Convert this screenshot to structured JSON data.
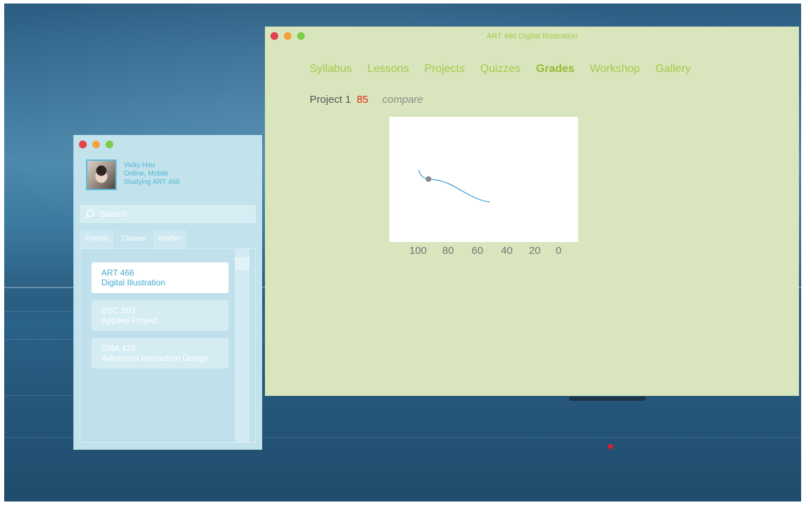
{
  "course_window": {
    "title": "ART 466 Digital Illustration",
    "tabs": [
      {
        "label": "Syllabus",
        "active": false
      },
      {
        "label": "Lessons",
        "active": false
      },
      {
        "label": "Projects",
        "active": false
      },
      {
        "label": "Quizzes",
        "active": false
      },
      {
        "label": "Grades",
        "active": true
      },
      {
        "label": "Workshop",
        "active": false
      },
      {
        "label": "Gallery",
        "active": false
      }
    ],
    "grade": {
      "project_label": "Project 1",
      "score": "85",
      "compare_label": "compare"
    },
    "chart_ticks": [
      "100",
      "80",
      "60",
      "40",
      "20",
      "0"
    ]
  },
  "friends_window": {
    "profile": {
      "name": "Vicky Hsu",
      "status": "Online, Mobile",
      "activity": "Studying ART 466"
    },
    "search_placeholder": "Search",
    "tabs": [
      {
        "label": "Friends",
        "active": false
      },
      {
        "label": "Classes",
        "active": true
      },
      {
        "label": "Notifier",
        "active": false
      }
    ],
    "classes": [
      {
        "code": "ART 466",
        "name": "Digital Illustration",
        "active": true
      },
      {
        "code": "DSC 593",
        "name": "Applied Project",
        "active": false
      },
      {
        "code": "GRA 423",
        "name": "Advanced Interaction Design",
        "active": false
      }
    ]
  },
  "colors": {
    "course_bg": "#d9e6bd",
    "course_accent": "#a7c84b",
    "score_red": "#e2231a",
    "friends_bg": "#c2e2ec",
    "friends_accent": "#54b7d3",
    "curve_blue": "#3d9fd4"
  },
  "icons": [
    "search-icon",
    "close-icon",
    "minimize-icon",
    "zoom-icon"
  ]
}
